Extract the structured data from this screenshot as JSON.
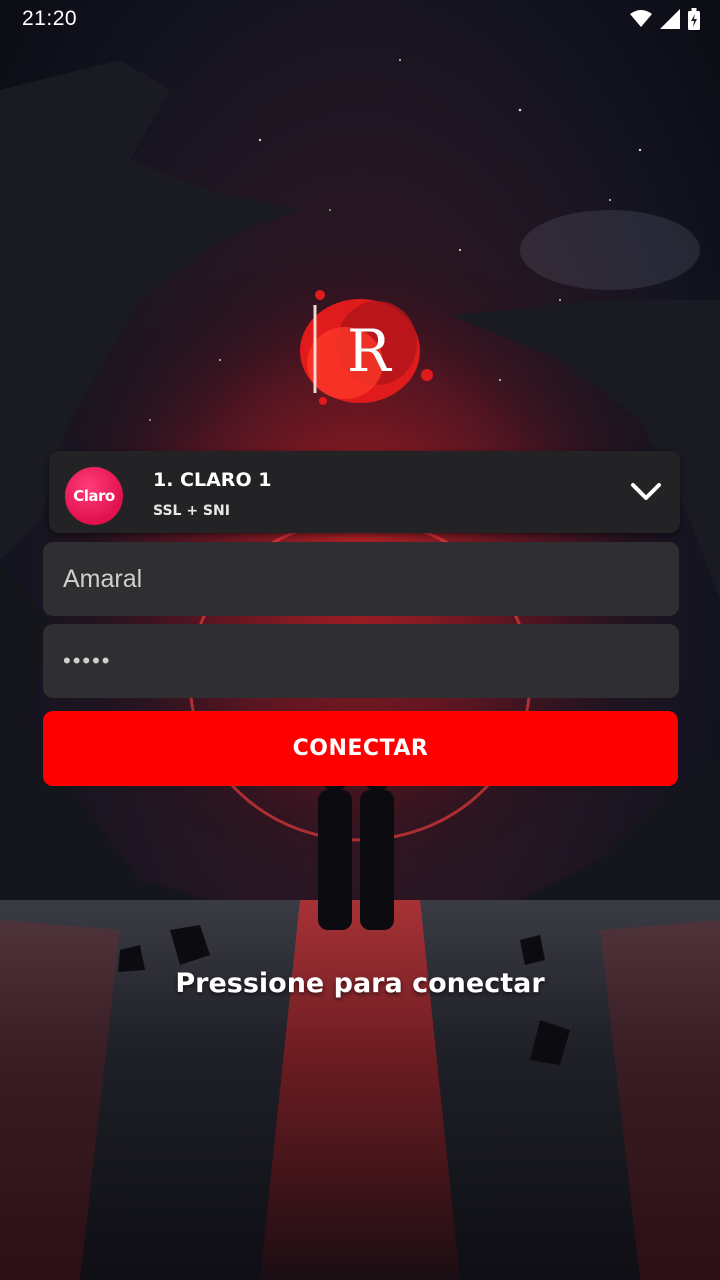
{
  "status_bar": {
    "time": "21:20",
    "icons": [
      "wifi-icon",
      "signal-icon",
      "battery-charging-icon"
    ]
  },
  "logo": {
    "letter": "R",
    "icon": "brand-logo-icon"
  },
  "server": {
    "name": "1. CLARO 1",
    "mode": "SSL + SNI",
    "badge_text": "Claro",
    "badge_color": "#e0114c",
    "dropdown_icon": "chevron-down-icon"
  },
  "login": {
    "username": "Amaral",
    "password_masked": "•••••"
  },
  "connect_button": {
    "label": "CONECTAR",
    "color": "#ff0000"
  },
  "hint": "Pressione para conectar"
}
